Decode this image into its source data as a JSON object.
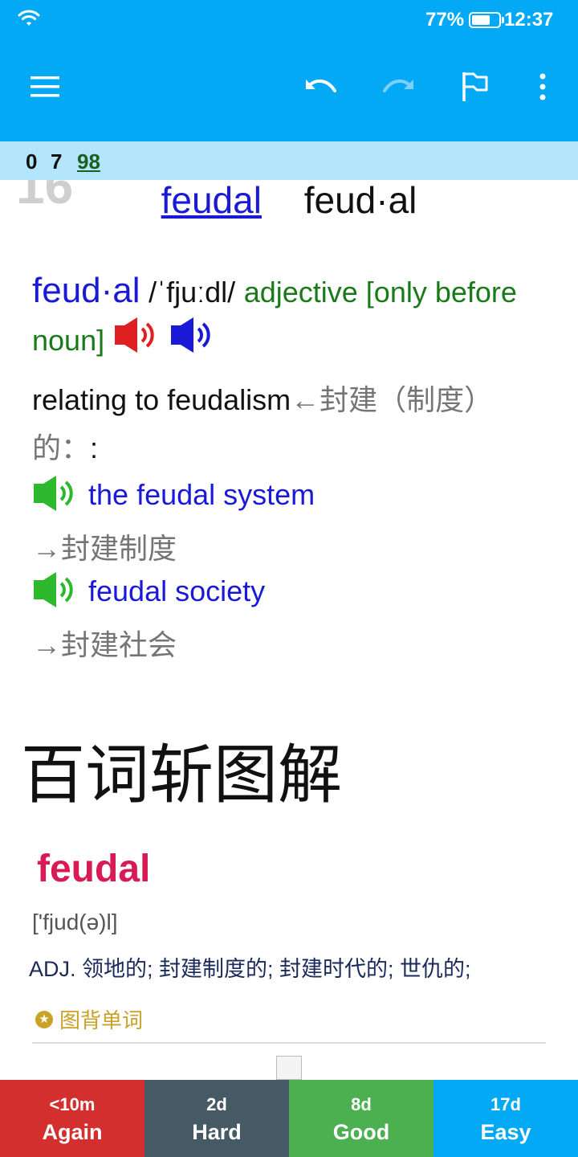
{
  "status_bar": {
    "battery_percent": "77%",
    "time": "12:37",
    "icons": [
      "wifi-icon",
      "battery-icon"
    ]
  },
  "toolbar": {
    "icons": [
      "menu-icon",
      "undo-icon",
      "redo-icon",
      "flag-icon",
      "more-vert-icon"
    ]
  },
  "counters": {
    "new": "0",
    "learning": "7",
    "review": "98"
  },
  "card": {
    "ghost_number": "16",
    "front_link": "feudal",
    "front_syllables": "feud·al",
    "headword": "feud·al",
    "pronunciation": "/ˈfjuːdl/",
    "pos_label": "adjective [only before noun]",
    "definition_en": "relating to feudalism",
    "definition_zh": "←封建（制度）的：",
    "definition_tail": ":",
    "examples": [
      {
        "en": "the feudal system",
        "zh": "→封建制度"
      },
      {
        "en": "feudal society",
        "zh": "→封建社会"
      }
    ]
  },
  "baicizhan": {
    "section_title": "百词斩图解",
    "word": "feudal",
    "phonetic": "['fjud(ə)l]",
    "definition": "ADJ. 领地的; 封建制度的; 封建时代的; 世仇的;",
    "study_link": "图背单词"
  },
  "answers": [
    {
      "interval": "<10m",
      "label": "Again"
    },
    {
      "interval": "2d",
      "label": "Hard"
    },
    {
      "interval": "8d",
      "label": "Good"
    },
    {
      "interval": "17d",
      "label": "Easy"
    }
  ],
  "colors": {
    "primary": "#03a9f4",
    "counter_strip": "#b3e5fc",
    "again": "#d32f2f",
    "hard": "#455a64",
    "good": "#4caf50",
    "easy": "#03a9f4",
    "headword": "#1a1ad6",
    "pos": "#1a7a1a",
    "baicizhan_word": "#d81b55"
  }
}
